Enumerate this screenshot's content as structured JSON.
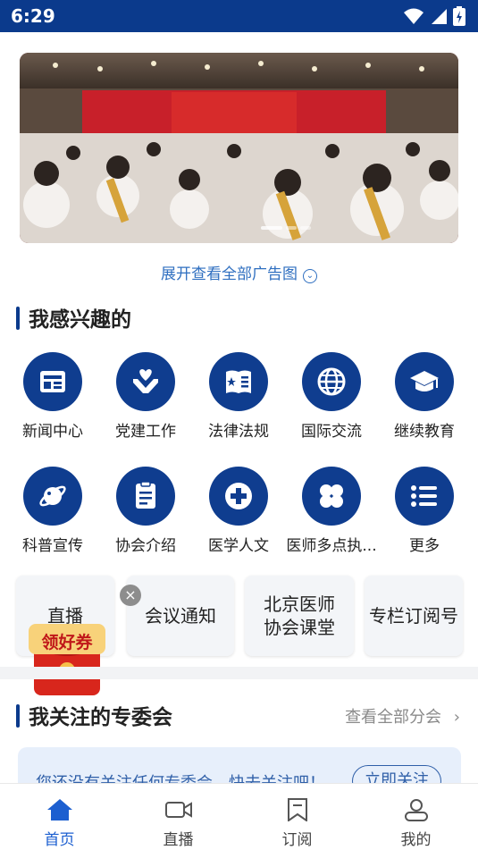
{
  "status_bar": {
    "time": "6:29"
  },
  "banner": {
    "alt": "会议现场"
  },
  "expand_ads": {
    "label": "展开查看全部广告图",
    "icon": "chevron-down-circle-icon"
  },
  "interest": {
    "title": "我感兴趣的",
    "items": [
      {
        "label": "新闻中心",
        "icon": "newspaper-icon"
      },
      {
        "label": "党建工作",
        "icon": "hands-heart-icon"
      },
      {
        "label": "法律法规",
        "icon": "law-book-icon"
      },
      {
        "label": "国际交流",
        "icon": "globe-icon"
      },
      {
        "label": "继续教育",
        "icon": "graduation-cap-icon"
      },
      {
        "label": "科普宣传",
        "icon": "planet-icon"
      },
      {
        "label": "协会介绍",
        "icon": "document-icon"
      },
      {
        "label": "医学人文",
        "icon": "medical-cross-icon"
      },
      {
        "label": "医师多点执...",
        "icon": "clover-icon"
      },
      {
        "label": "更多",
        "icon": "list-icon"
      }
    ]
  },
  "cards": [
    {
      "label": "直播"
    },
    {
      "label": "会议通知"
    },
    {
      "label": "北京医师协会课堂"
    },
    {
      "label": "专栏订阅号"
    }
  ],
  "coupon": {
    "label": "领好券"
  },
  "followed": {
    "title": "我关注的专委会",
    "more": "查看全部分会",
    "empty_text": "您还没有关注任何专委会，快去关注吧！",
    "follow_button": "立即关注"
  },
  "tabbar": {
    "tabs": [
      {
        "label": "首页",
        "icon": "home-icon",
        "active": true
      },
      {
        "label": "直播",
        "icon": "video-camera-icon",
        "active": false
      },
      {
        "label": "订阅",
        "icon": "bookmark-icon",
        "active": false
      },
      {
        "label": "我的",
        "icon": "user-icon",
        "active": false
      }
    ]
  },
  "colors": {
    "primary": "#0f3d8f",
    "link": "#2f6fc0",
    "active_tab": "#1c5fd0",
    "status_bar": "#0b3a8c"
  }
}
